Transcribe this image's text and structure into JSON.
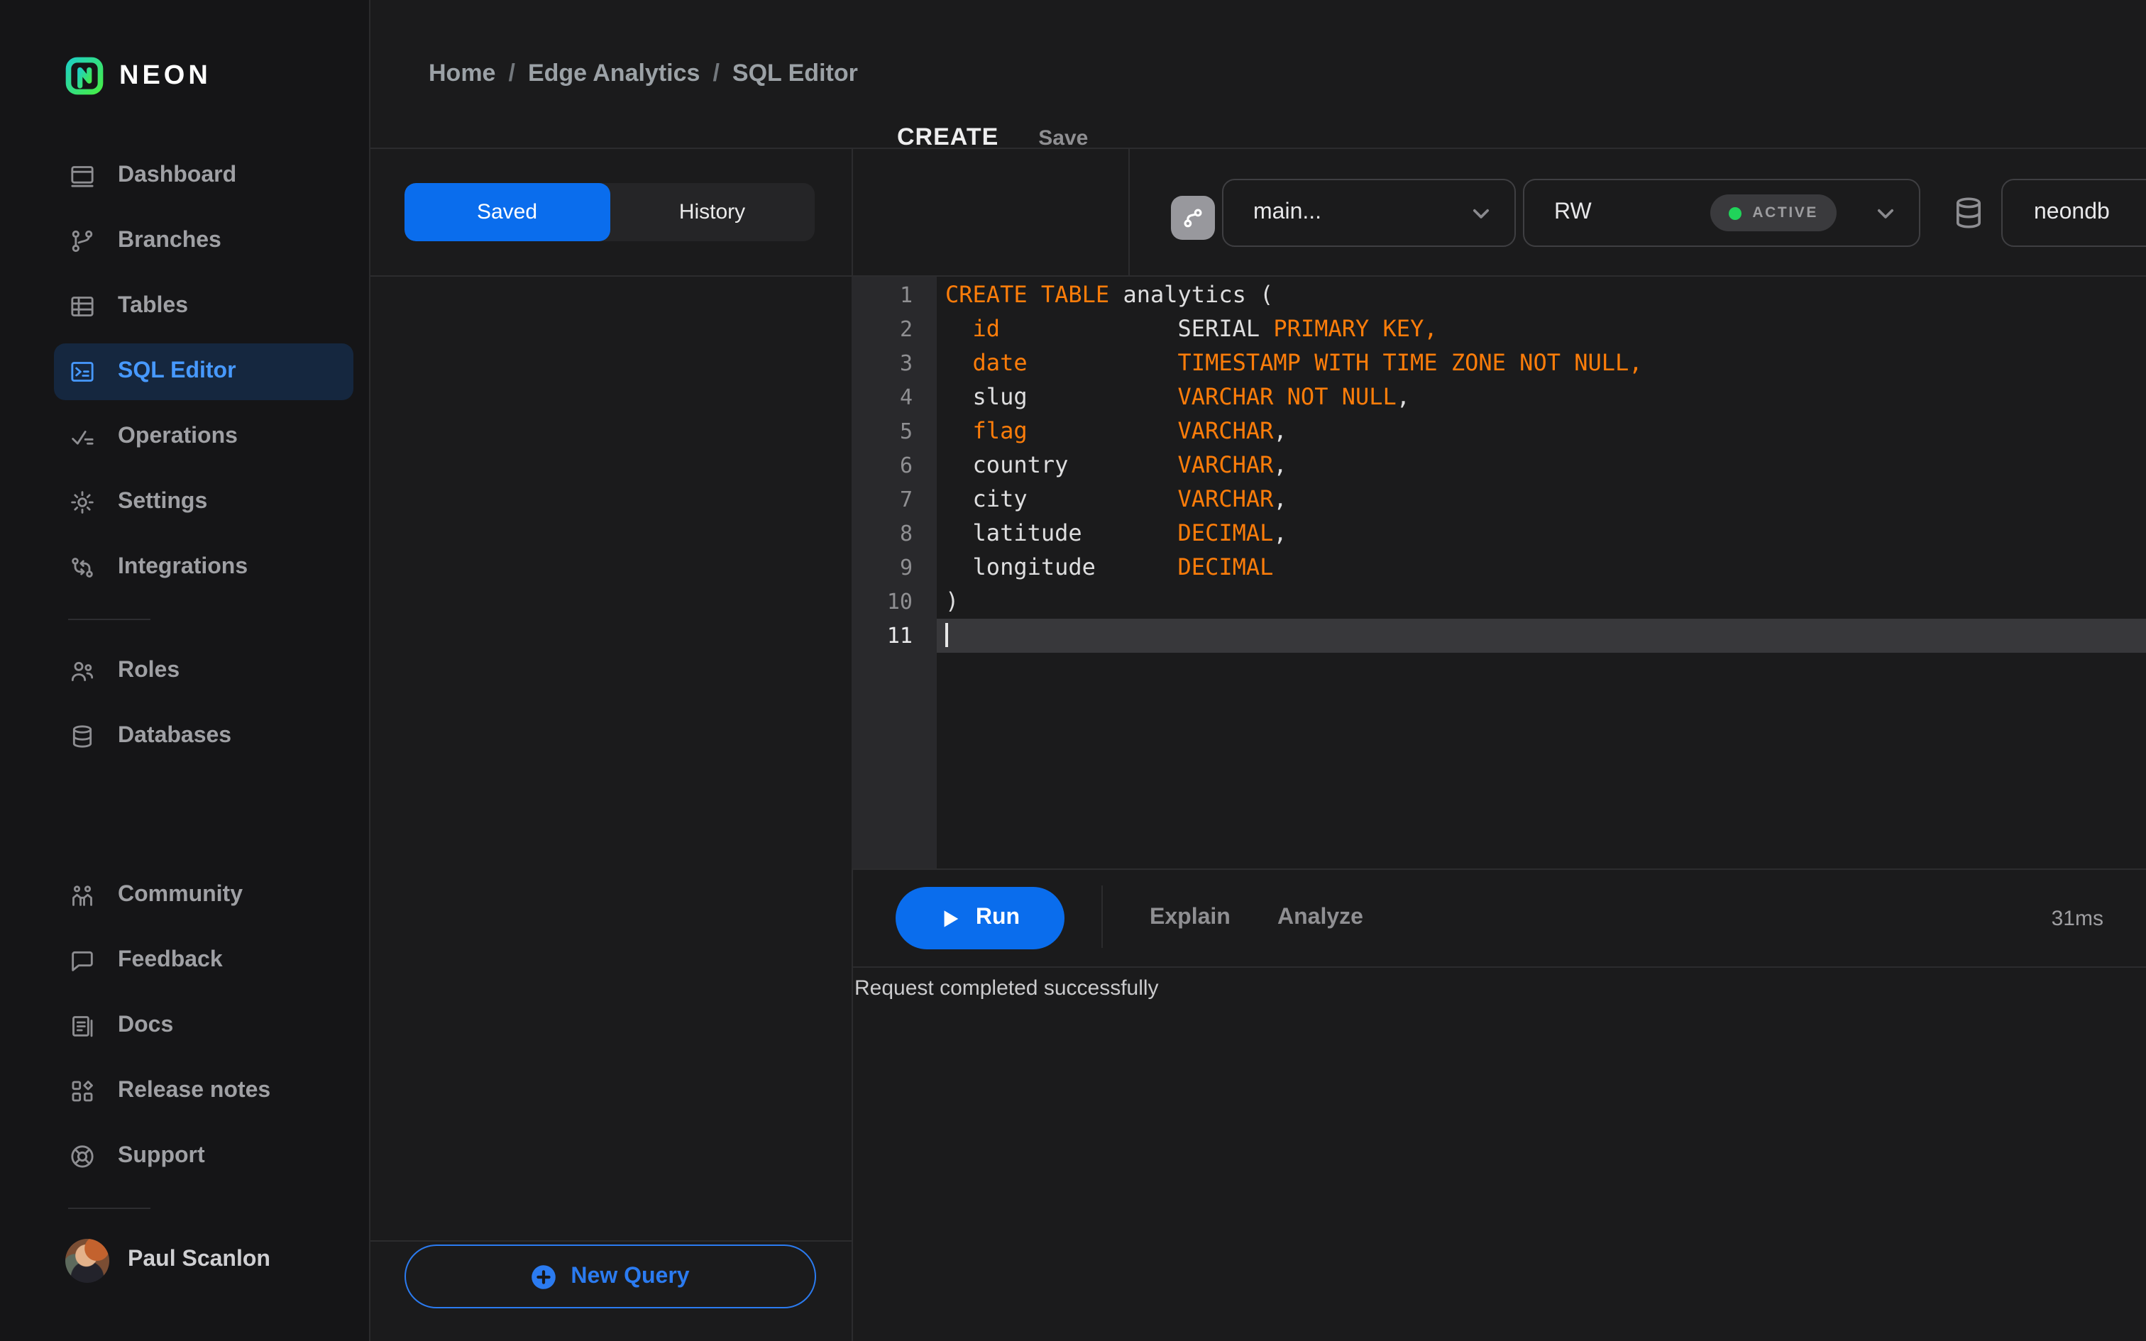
{
  "brand": {
    "name": "NEON"
  },
  "breadcrumb": {
    "segments": [
      "Home",
      "Edge Analytics",
      "SQL Editor"
    ],
    "separator": "/"
  },
  "sidebar": {
    "primary": [
      {
        "id": "dashboard",
        "label": "Dashboard",
        "icon": "dashboard-icon"
      },
      {
        "id": "branches",
        "label": "Branches",
        "icon": "branches-icon"
      },
      {
        "id": "tables",
        "label": "Tables",
        "icon": "tables-icon"
      },
      {
        "id": "sql-editor",
        "label": "SQL Editor",
        "icon": "sql-editor-icon",
        "active": true
      },
      {
        "id": "operations",
        "label": "Operations",
        "icon": "operations-icon"
      },
      {
        "id": "settings",
        "label": "Settings",
        "icon": "settings-icon"
      },
      {
        "id": "integrations",
        "label": "Integrations",
        "icon": "integrations-icon"
      }
    ],
    "secondary": [
      {
        "id": "roles",
        "label": "Roles",
        "icon": "roles-icon"
      },
      {
        "id": "databases",
        "label": "Databases",
        "icon": "databases-icon"
      }
    ],
    "tertiary": [
      {
        "id": "community",
        "label": "Community",
        "icon": "community-icon"
      },
      {
        "id": "feedback",
        "label": "Feedback",
        "icon": "feedback-icon"
      },
      {
        "id": "docs",
        "label": "Docs",
        "icon": "docs-icon"
      },
      {
        "id": "release-notes",
        "label": "Release notes",
        "icon": "release-notes-icon"
      },
      {
        "id": "support",
        "label": "Support",
        "icon": "support-icon"
      }
    ],
    "user": {
      "name": "Paul Scanlon"
    }
  },
  "query_panel": {
    "tabs": [
      {
        "id": "saved",
        "label": "Saved",
        "active": true
      },
      {
        "id": "history",
        "label": "History"
      }
    ],
    "new_query_label": "New Query"
  },
  "editor": {
    "title": "CREATE",
    "save_label": "Save",
    "branch_select": {
      "value": "main..."
    },
    "compute_select": {
      "value": "RW",
      "status": "ACTIVE"
    },
    "database_select": {
      "value": "neondb"
    },
    "code": {
      "active_line": 11,
      "lines": [
        [
          {
            "t": "CREATE TABLE",
            "k": 1
          },
          {
            "t": " analytics ("
          }
        ],
        [
          {
            "t": "  "
          },
          {
            "t": "id",
            "k": 1
          },
          {
            "t": "             "
          },
          {
            "t": "SERIAL "
          },
          {
            "t": "PRIMARY KEY,",
            "k": 1
          }
        ],
        [
          {
            "t": "  "
          },
          {
            "t": "date",
            "k": 1
          },
          {
            "t": "           "
          },
          {
            "t": "TIMESTAMP WITH TIME ZONE NOT NULL,",
            "k": 1
          }
        ],
        [
          {
            "t": "  slug           "
          },
          {
            "t": "VARCHAR NOT NULL",
            "k": 1
          },
          {
            "t": ","
          }
        ],
        [
          {
            "t": "  "
          },
          {
            "t": "flag",
            "k": 1
          },
          {
            "t": "           "
          },
          {
            "t": "VARCHAR",
            "k": 1
          },
          {
            "t": ","
          }
        ],
        [
          {
            "t": "  country        "
          },
          {
            "t": "VARCHAR",
            "k": 1
          },
          {
            "t": ","
          }
        ],
        [
          {
            "t": "  city           "
          },
          {
            "t": "VARCHAR",
            "k": 1
          },
          {
            "t": ","
          }
        ],
        [
          {
            "t": "  latitude       "
          },
          {
            "t": "DECIMAL",
            "k": 1
          },
          {
            "t": ","
          }
        ],
        [
          {
            "t": "  longitude      "
          },
          {
            "t": "DECIMAL",
            "k": 1
          }
        ],
        [
          {
            "t": ")"
          }
        ],
        []
      ]
    },
    "toolbar": {
      "run_label": "Run",
      "explain_label": "Explain",
      "analyze_label": "Analyze",
      "duration": "31ms"
    },
    "result_message": "Request completed successfully"
  },
  "colors": {
    "accent_blue": "#0a6ded",
    "keyword_orange": "#fd7d0a",
    "status_green": "#20d45a",
    "active_item_blue": "#4799ff"
  }
}
